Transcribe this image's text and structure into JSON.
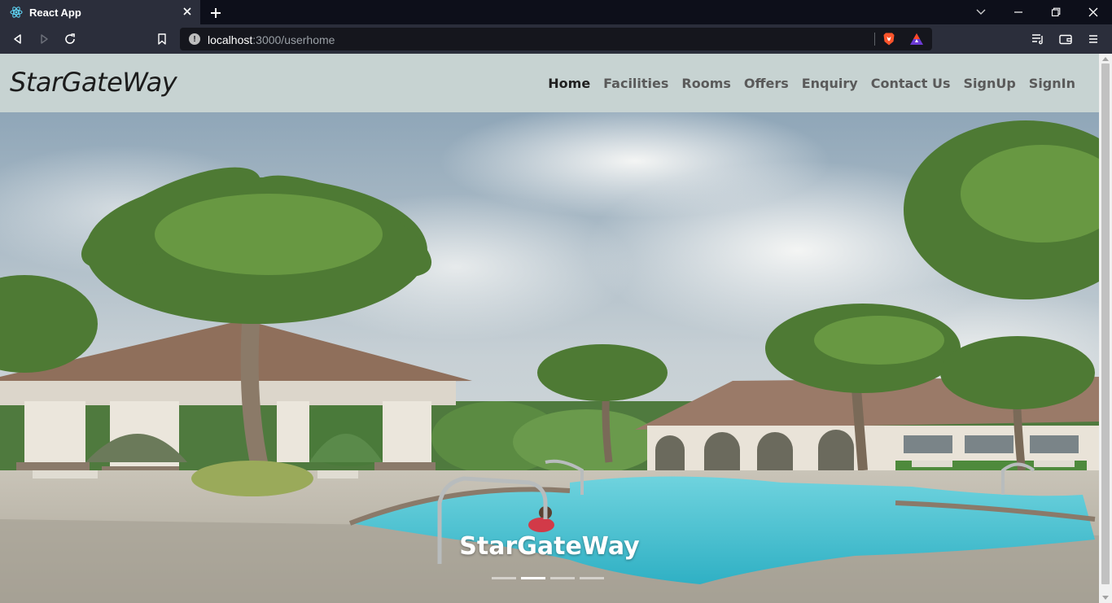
{
  "browser": {
    "tab_title": "React App",
    "url_host": "localhost",
    "url_path": ":3000/userhome"
  },
  "navbar": {
    "brand": "StarGateWay",
    "links": [
      "Home",
      "Facilities",
      "Rooms",
      "Offers",
      "Enquiry",
      "Contact Us",
      "SignUp",
      "SignIn"
    ],
    "active": "Home"
  },
  "hero": {
    "caption": "StarGateWay",
    "slides_count": 4,
    "active_slide": 2
  },
  "colors": {
    "navbar_bg": "#c7d3d2",
    "pool": "#43bfcf",
    "sky": "#b9c6cf"
  }
}
